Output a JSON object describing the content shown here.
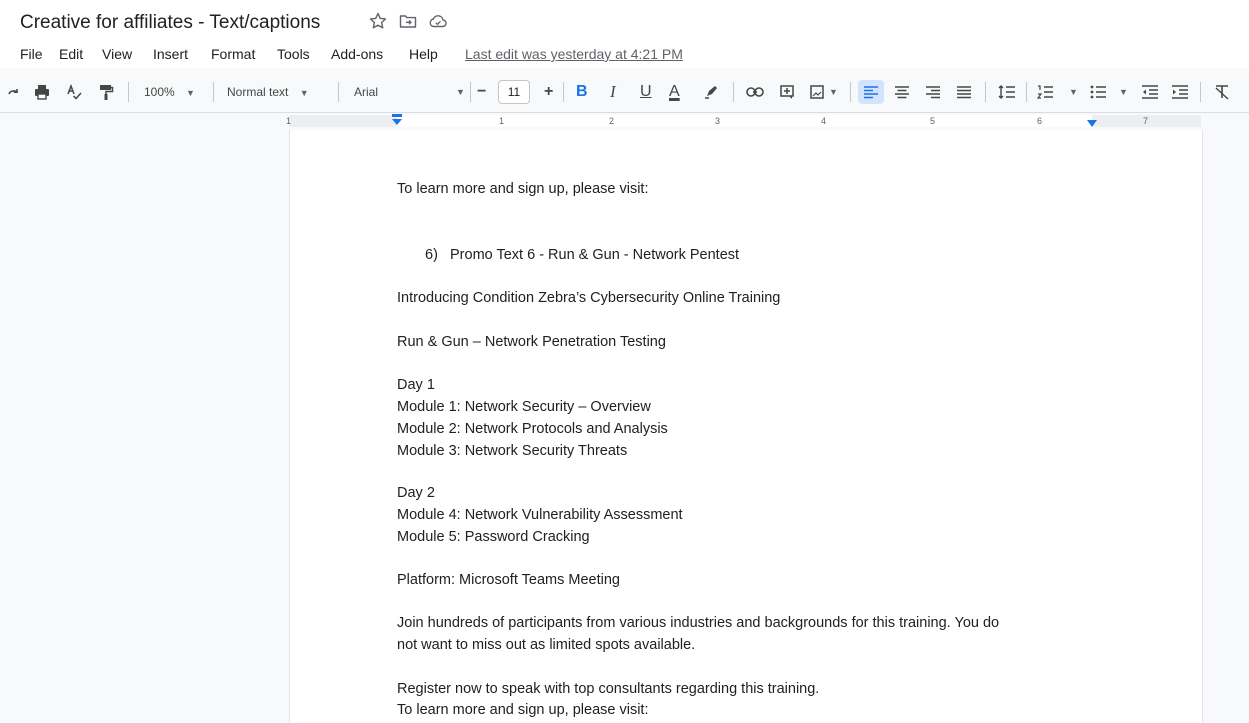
{
  "document": {
    "title": "Creative for affiliates - Text/captions",
    "last_edit": "Last edit was yesterday at 4:21 PM"
  },
  "menu": [
    "File",
    "Edit",
    "View",
    "Insert",
    "Format",
    "Tools",
    "Add-ons",
    "Help"
  ],
  "toolbar": {
    "zoom": "100%",
    "style": "Normal text",
    "font": "Arial",
    "font_size": "11",
    "minus": "−",
    "plus": "+",
    "bold": "B",
    "italic": "I",
    "underline": "U",
    "text_color": "A"
  },
  "ruler": {
    "numbers": [
      "1",
      "1",
      "2",
      "3",
      "4",
      "5",
      "6",
      "7"
    ]
  },
  "body": {
    "line_visit_1": "To learn more and sign up, please visit:",
    "list_number": "6)",
    "list_item": "Promo Text 6 - Run & Gun - Network Pentest",
    "intro": "Introducing Condition Zebra’s Cybersecurity Online Training",
    "course": "Run & Gun – Network Penetration Testing",
    "day1": "Day 1",
    "module1": "Module 1: Network Security – Overview",
    "module2": "Module 2: Network Protocols and Analysis",
    "module3": "Module 3: Network Security Threats",
    "day2": "Day 2",
    "module4": "Module 4: Network Vulnerability Assessment",
    "module5": "Module 5: Password Cracking",
    "platform": "Platform: Microsoft Teams Meeting",
    "join_1": "Join hundreds of participants from various industries and backgrounds for this training. You do",
    "join_2": "not want to miss out as limited spots available.",
    "register": "Register now to speak with top consultants regarding this training.",
    "line_visit_2": "To learn more and sign up, please visit:"
  },
  "colors": {
    "accent": "#1a73e8",
    "text": "#202124",
    "muted": "#5f6368"
  }
}
